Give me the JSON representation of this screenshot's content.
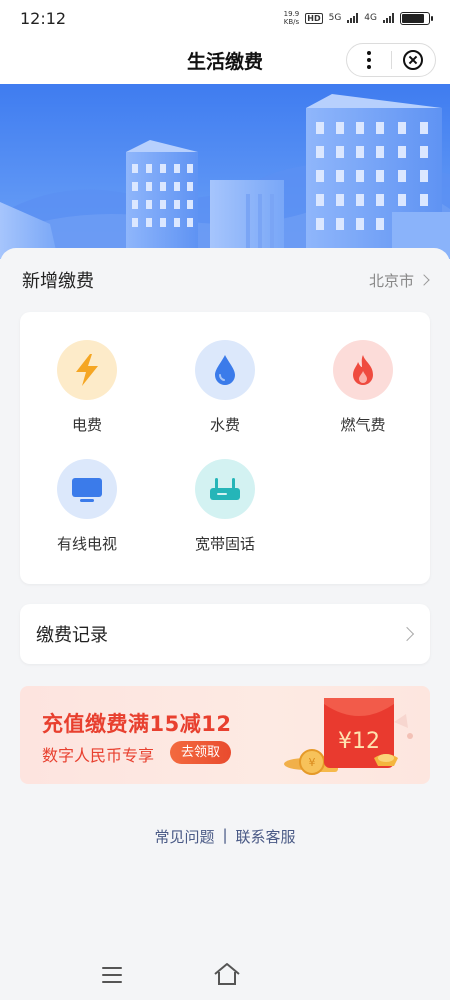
{
  "status_bar": {
    "time": "12:12",
    "speed_value": "19.9",
    "speed_unit": "KB/s",
    "hd": "HD",
    "net1": "5G",
    "net2": "4G"
  },
  "nav": {
    "title": "生活缴费"
  },
  "new_payment": {
    "title": "新增缴费",
    "city": "北京市",
    "items": [
      {
        "label": "电费",
        "icon": "lightning-icon",
        "bg": "#fdebc9",
        "color": "#f5a623"
      },
      {
        "label": "水费",
        "icon": "water-drop-icon",
        "bg": "#dce8fb",
        "color": "#3b7bea"
      },
      {
        "label": "燃气费",
        "icon": "flame-icon",
        "bg": "#fcdcd9",
        "color": "#ef4b3f"
      },
      {
        "label": "有线电视",
        "icon": "tv-icon",
        "bg": "#dce8fb",
        "color": "#3b7bea"
      },
      {
        "label": "宽带固话",
        "icon": "router-icon",
        "bg": "#d3f2f2",
        "color": "#25b5b8"
      }
    ]
  },
  "records": {
    "label": "缴费记录"
  },
  "promo": {
    "title": "充值缴费满15减12",
    "subtitle": "数字人民币专享",
    "button": "去领取",
    "envelope_amount": "¥12"
  },
  "footer_links": {
    "faq": "常见问题",
    "separator": "|",
    "support": "联系客服"
  },
  "colors": {
    "banner": "#3f7cf0",
    "promo_text": "#e8402f",
    "link": "#4a5a86"
  }
}
